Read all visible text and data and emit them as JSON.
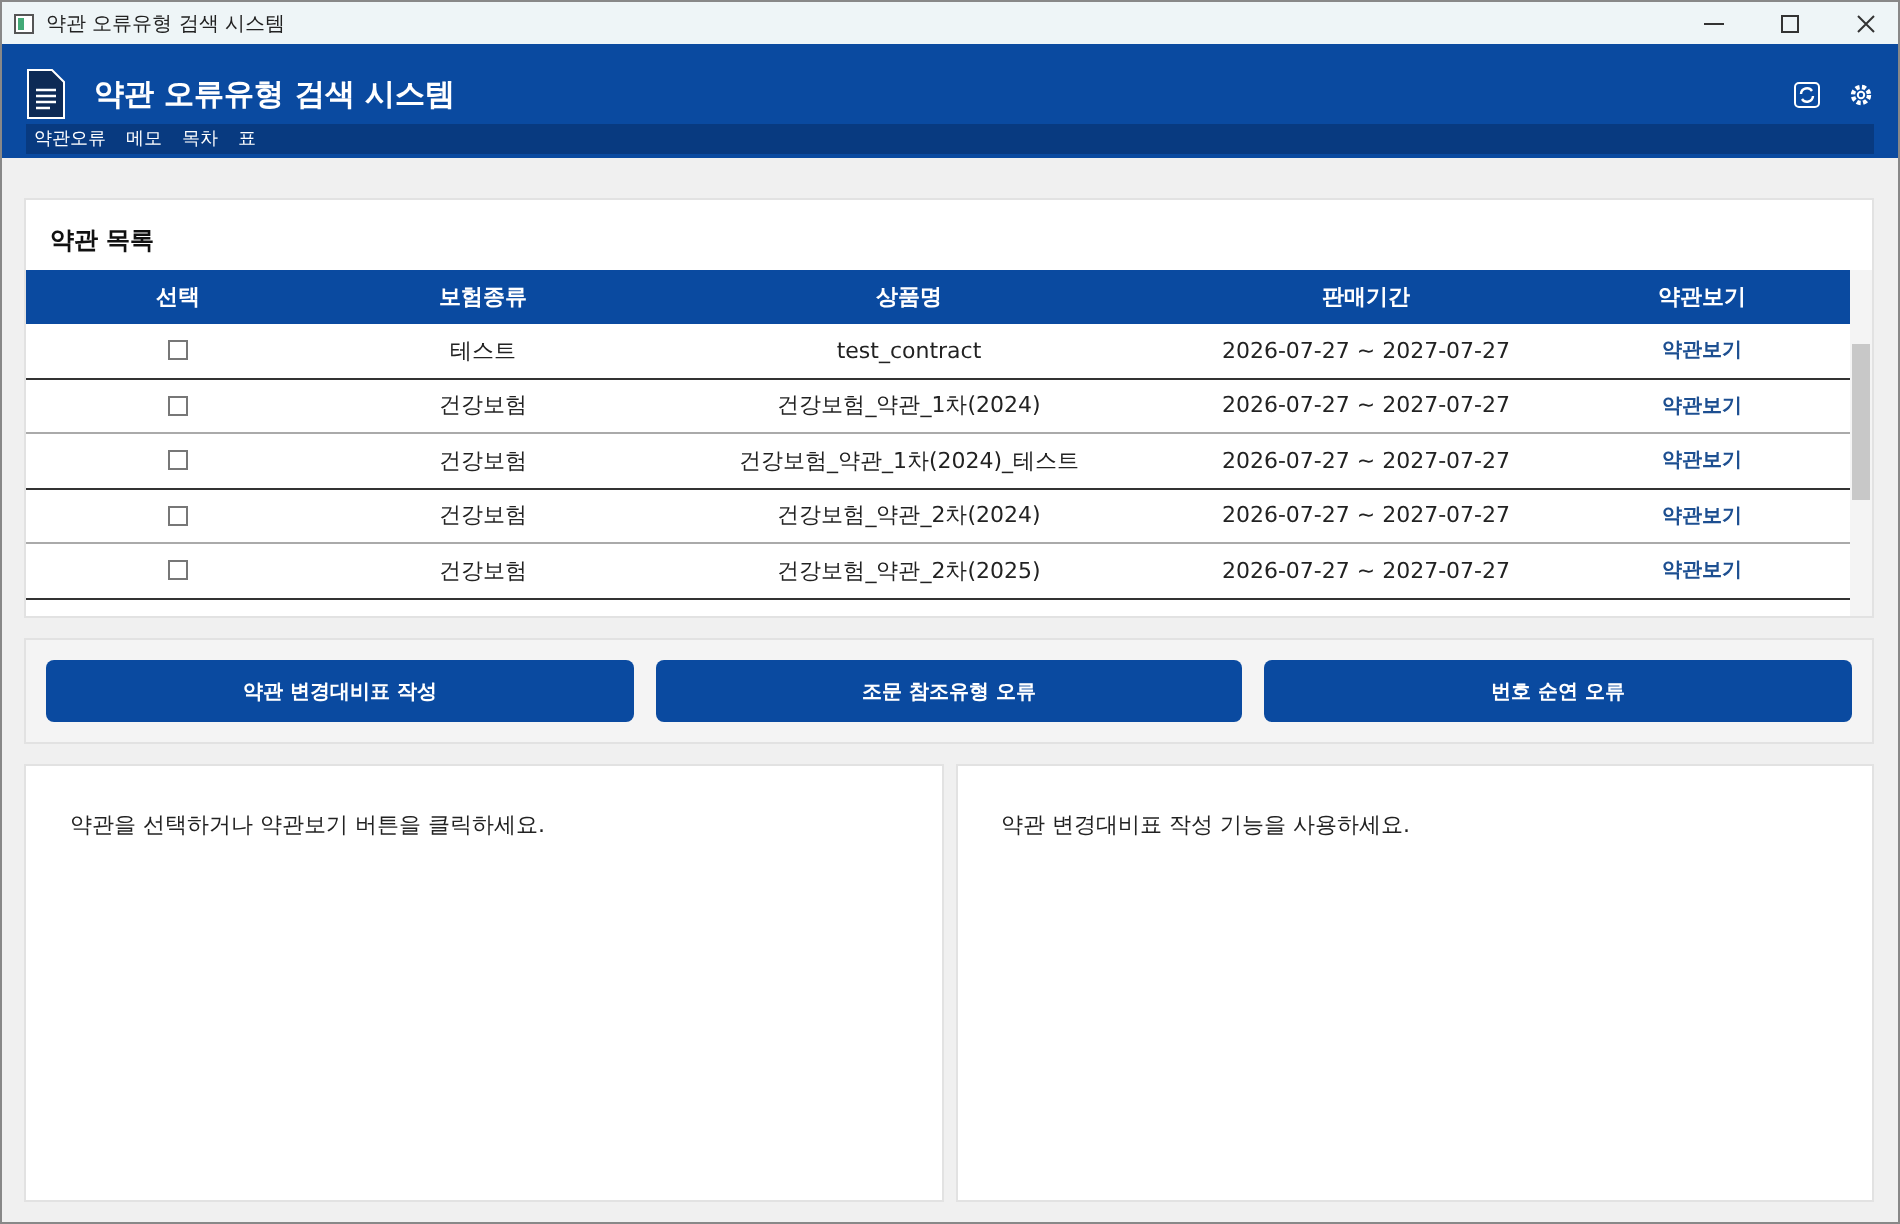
{
  "window": {
    "title": "약관 오류유형 검색 시스템"
  },
  "header": {
    "title": "약관 오류유형 검색 시스템"
  },
  "menu": [
    "약관오류",
    "메모",
    "목차",
    "표"
  ],
  "table": {
    "title": "약관 목록",
    "columns": [
      "선택",
      "보험종류",
      "상품명",
      "판매기간",
      "약관보기"
    ],
    "rows": [
      {
        "checked": false,
        "type": "테스트",
        "name": "test_contract",
        "period": "2026-07-27 ~ 2027-07-27",
        "link": "약관보기"
      },
      {
        "checked": false,
        "type": "건강보험",
        "name": "건강보험_약관_1차(2024)",
        "period": "2026-07-27 ~ 2027-07-27",
        "link": "약관보기"
      },
      {
        "checked": false,
        "type": "건강보험",
        "name": "건강보험_약관_1차(2024)_테스트",
        "period": "2026-07-27 ~ 2027-07-27",
        "link": "약관보기"
      },
      {
        "checked": false,
        "type": "건강보험",
        "name": "건강보험_약관_2차(2024)",
        "period": "2026-07-27 ~ 2027-07-27",
        "link": "약관보기"
      },
      {
        "checked": false,
        "type": "건강보험",
        "name": "건강보험_약관_2차(2025)",
        "period": "2026-07-27 ~ 2027-07-27",
        "link": "약관보기"
      }
    ]
  },
  "actions": [
    "약관 변경대비표 작성",
    "조문 참조유형 오류",
    "번호 순연 오류"
  ],
  "panels": [
    "약관을 선택하거나 약관보기 버튼을 클릭하세요.",
    "약관 변경대비표 작성 기능을 사용하세요."
  ]
}
